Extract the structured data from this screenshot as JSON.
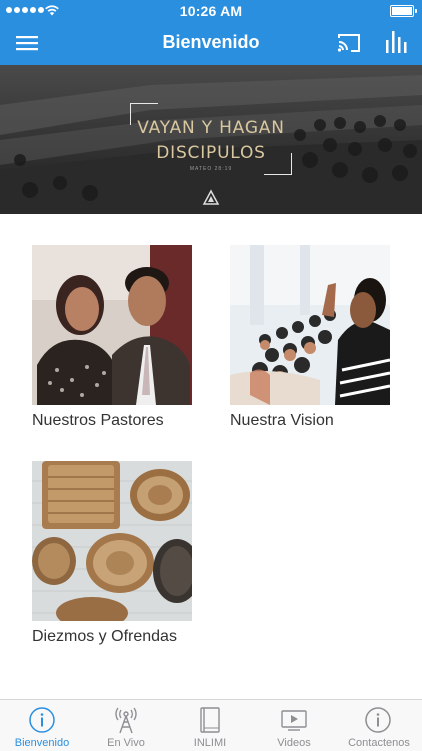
{
  "status_bar": {
    "time": "10:26 AM"
  },
  "header": {
    "title": "Bienvenido",
    "menu_icon": "hamburger-menu-icon",
    "cast_icon": "cast-icon",
    "stats_icon": "bar-chart-icon"
  },
  "banner": {
    "line1": "VAYAN Y HAGAN",
    "line2": "DISCIPULOS",
    "reference": "MATEO 28:19"
  },
  "grid": [
    {
      "caption": "Nuestros Pastores"
    },
    {
      "caption": "Nuestra Vision"
    },
    {
      "caption": "Diezmos y Ofrendas"
    }
  ],
  "tabbar": {
    "tabs": [
      {
        "label": "Bienvenido",
        "icon": "info-icon",
        "active": true
      },
      {
        "label": "En Vivo",
        "icon": "radio-tower-icon",
        "active": false
      },
      {
        "label": "INLIMI",
        "icon": "book-icon",
        "active": false
      },
      {
        "label": "Videos",
        "icon": "video-play-icon",
        "active": false
      },
      {
        "label": "Contactenos",
        "icon": "info-icon",
        "active": false
      }
    ]
  },
  "colors": {
    "accent": "#2b8fe0",
    "tab_inactive": "#8e8e93"
  }
}
